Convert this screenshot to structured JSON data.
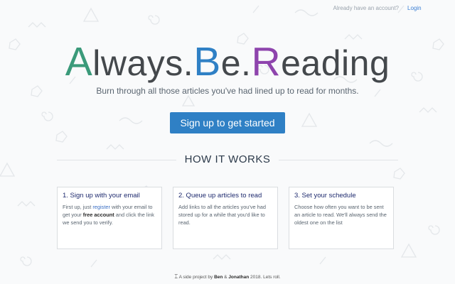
{
  "topbar": {
    "prompt": "Already have an account?",
    "login": "Login"
  },
  "hero": {
    "words": [
      "A",
      "lways",
      ".",
      "B",
      "e",
      ".",
      "R",
      "eading"
    ],
    "colors": {
      "a": "#3b9a7a",
      "b": "#2f80c5",
      "r": "#8e44ad",
      "rest": "#44484c"
    }
  },
  "subtitle": "Burn through all those articles you've had lined up to read for months.",
  "cta": {
    "label": "Sign up to get started",
    "color": "#2f80c5"
  },
  "how": {
    "heading": "HOW IT WORKS"
  },
  "cards": [
    {
      "title": "1. Sign up with your email",
      "body": [
        "First up, just ",
        "register",
        " with your email to get your ",
        "free account",
        " and click the link we send you to verify."
      ]
    },
    {
      "title": "2. Queue up articles to read",
      "body": "Add links to all the articles you've had stored up for a while that you'd like to read."
    },
    {
      "title": "3. Set your schedule",
      "body": "Choose how often you want to be sent an article to read. We'll always send the oldest one on the list"
    }
  ],
  "footer": [
    "A side project by ",
    "Ben",
    " & ",
    "Jonathan",
    " 2018. Lets roll."
  ]
}
